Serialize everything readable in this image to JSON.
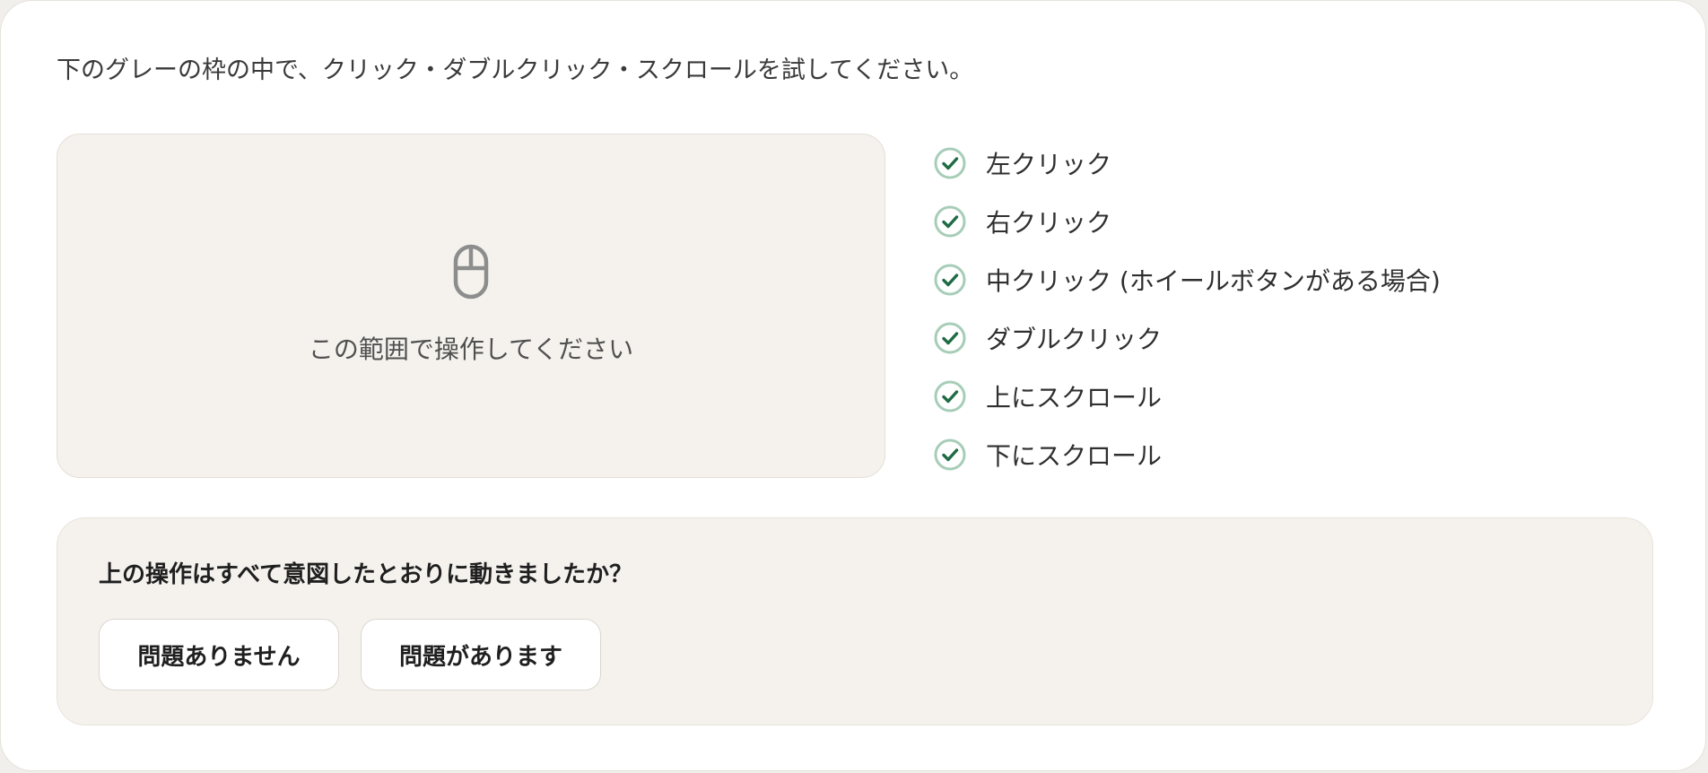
{
  "instruction": "下のグレーの枠の中で、クリック・ダブルクリック・スクロールを試してください。",
  "test_area": {
    "icon": "mouse-icon",
    "label": "この範囲で操作してください"
  },
  "checklist": {
    "icon": "check-circle-icon",
    "check_color": "#1f6b45",
    "items": [
      {
        "label": "左クリック",
        "checked": true
      },
      {
        "label": "右クリック",
        "checked": true
      },
      {
        "label": "中クリック (ホイールボタンがある場合)",
        "checked": true
      },
      {
        "label": "ダブルクリック",
        "checked": true
      },
      {
        "label": "上にスクロール",
        "checked": true
      },
      {
        "label": "下にスクロール",
        "checked": true
      }
    ]
  },
  "question_panel": {
    "question": "上の操作はすべて意図したとおりに動きましたか？",
    "buttons": {
      "no_problem": "問題ありません",
      "has_problem": "問題があります"
    }
  }
}
